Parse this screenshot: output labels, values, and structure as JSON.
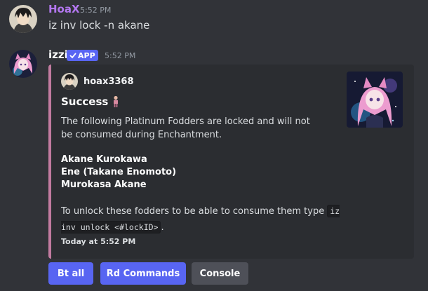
{
  "messages": [
    {
      "author": "HoaX",
      "time": "5:52 PM",
      "text": "iz inv lock -n akane",
      "avatar_icon": "anime-boy-avatar"
    },
    {
      "author": "izzi",
      "badge": "APP",
      "time": "5:52 PM",
      "avatar_icon": "anime-catgirl-avatar"
    }
  ],
  "embed": {
    "accent_color": "#c27ba0",
    "author": "hoax3368",
    "title": "Success",
    "title_icon": "person-emoji",
    "description": "The following Platinum Fodders are locked and will not be consumed during Enchantment.",
    "fodders": [
      "Akane Kurokawa",
      "Ene (Takane Enomoto)",
      "Murokasa Akane"
    ],
    "unlock_prefix": "To unlock these fodders to be able to consume them type",
    "unlock_code": "iz inv unlock <#lockID>",
    "unlock_suffix": ".",
    "footer": "Today at 5:52 PM",
    "thumbnail_icon": "anime-catgirl-thumbnail"
  },
  "buttons": [
    {
      "label": "Bt all",
      "style": "primary"
    },
    {
      "label": "Rd Commands",
      "style": "primary"
    },
    {
      "label": "Console",
      "style": "secondary"
    }
  ]
}
